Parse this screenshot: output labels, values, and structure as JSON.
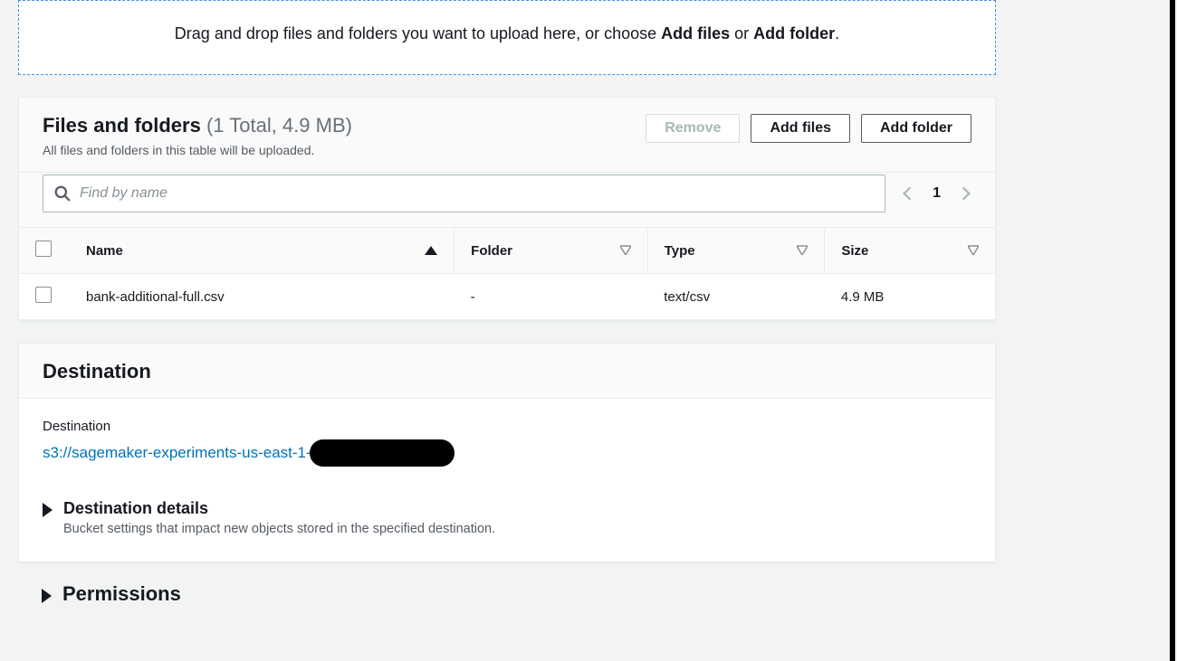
{
  "dropzone": {
    "text_prefix": "Drag and drop files and folders you want to upload here, or choose ",
    "add_files": "Add files",
    "or": " or ",
    "add_folder": "Add folder",
    "period": "."
  },
  "files_panel": {
    "title": "Files and folders",
    "count_text": "(1 Total, 4.9 MB)",
    "subtext": "All files and folders in this table will be uploaded.",
    "remove_label": "Remove",
    "add_files_label": "Add files",
    "add_folder_label": "Add folder",
    "search_placeholder": "Find by name",
    "page_number": "1",
    "columns": {
      "name": "Name",
      "folder": "Folder",
      "type": "Type",
      "size": "Size"
    },
    "rows": [
      {
        "name": "bank-additional-full.csv",
        "folder": "-",
        "type": "text/csv",
        "size": "4.9 MB"
      }
    ]
  },
  "destination_panel": {
    "title": "Destination",
    "label": "Destination",
    "link_text": "s3://sagemaker-experiments-us-east-1-",
    "details_title": "Destination details",
    "details_desc": "Bucket settings that impact new objects stored in the specified destination."
  },
  "permissions": {
    "title": "Permissions"
  }
}
